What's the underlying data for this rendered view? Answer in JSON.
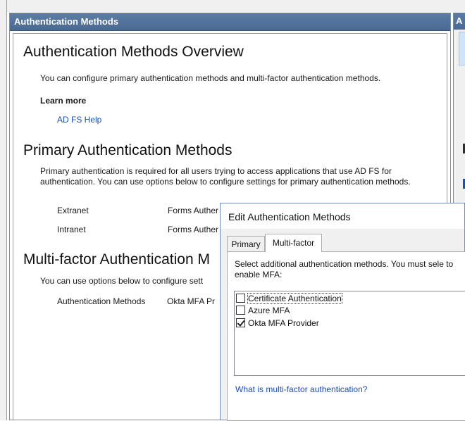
{
  "pane": {
    "header": "Authentication Methods",
    "overview_title": "Authentication Methods Overview",
    "overview_desc": "You can configure primary authentication methods and multi-factor authentication methods.",
    "learn_more": "Learn more",
    "help_link": "AD FS Help",
    "primary_title": "Primary Authentication Methods",
    "primary_desc": "Primary authentication is required for all users trying to access applications that use AD FS for authentication. You can use options below to configure settings for primary authentication methods.",
    "rows": [
      {
        "label": "Extranet",
        "value": "Forms Auther"
      },
      {
        "label": "Intranet",
        "value": "Forms Auther"
      }
    ],
    "mfa_title": "Multi-factor Authentication M",
    "mfa_desc": "You can use options below to configure sett",
    "mfa_row_label": "Authentication Methods",
    "mfa_row_value": "Okta MFA Pr"
  },
  "right_strip": {
    "header": "A"
  },
  "dialog": {
    "title": "Edit Authentication Methods",
    "tabs": [
      "Primary",
      "Multi-factor"
    ],
    "active_tab": "Multi-factor",
    "desc": "Select additional authentication methods. You must sele to enable MFA:",
    "methods": [
      {
        "label": "Certificate Authentication",
        "checked": false
      },
      {
        "label": "Azure MFA",
        "checked": false
      },
      {
        "label": "Okta MFA Provider",
        "checked": true
      }
    ],
    "help_link": "What is multi-factor authentication?"
  }
}
